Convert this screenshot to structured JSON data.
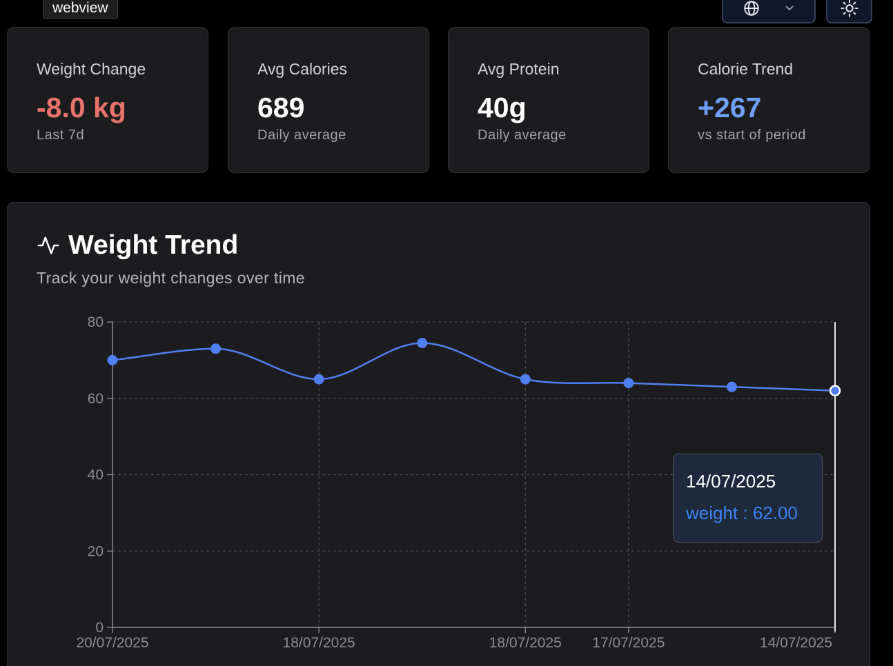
{
  "webview_label": "webview",
  "toolbar": {
    "language_icon": "globe-icon",
    "dropdown_icon": "chevron-down-icon",
    "theme_icon": "sun-icon"
  },
  "stats": [
    {
      "title": "Weight Change",
      "value": "-8.0 kg",
      "sub": "Last 7d",
      "color": "#e8736b"
    },
    {
      "title": "Avg Calories",
      "value": "689",
      "sub": "Daily average",
      "color": "#ffffff"
    },
    {
      "title": "Avg Protein",
      "value": "40g",
      "sub": "Daily average",
      "color": "#ffffff"
    },
    {
      "title": "Calorie Trend",
      "value": "+267",
      "sub": "vs start of period",
      "color": "#6ea0f7"
    }
  ],
  "weight_chart": {
    "title": "Weight Trend",
    "subtitle": "Track your weight changes over time",
    "icon": "activity-icon",
    "line_color": "#4f7ff0"
  },
  "tooltip": {
    "date": "14/07/2025",
    "label": "weight : 62.00"
  },
  "chart_data": {
    "type": "line",
    "xlabel": "",
    "ylabel": "",
    "ylim": [
      0,
      80
    ],
    "yticks": [
      0,
      20,
      40,
      60,
      80
    ],
    "grid": true,
    "x": [
      "20/07/2025",
      "",
      "18/07/2025",
      "",
      "18/07/2025",
      "17/07/2025",
      "",
      "14/07/2025"
    ],
    "series": [
      {
        "values": [
          70.0,
          73.0,
          65.0,
          74.5,
          65.0,
          64.0,
          63.0,
          62.0
        ]
      }
    ],
    "active_index": 7
  }
}
